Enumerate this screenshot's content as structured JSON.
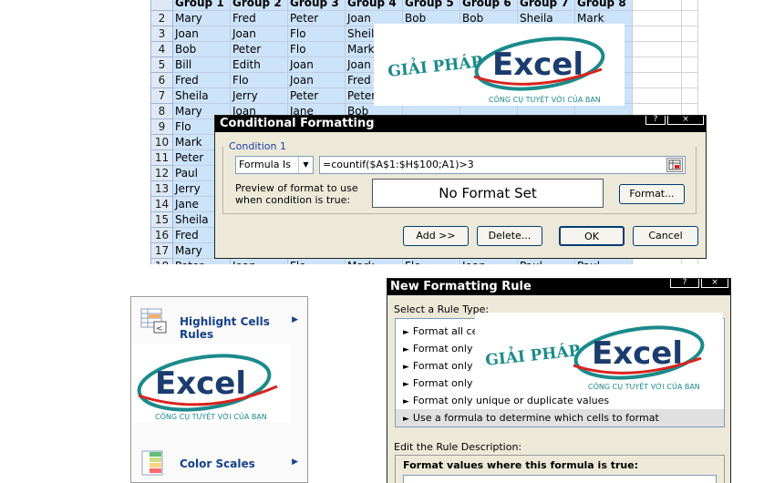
{
  "sheet": {
    "header_row": [
      "",
      "Group 1",
      "Group 2",
      "Group 3",
      "Group 4",
      "Group 5",
      "Group 6",
      "Group 7",
      "Group 8",
      "",
      ""
    ],
    "rows": [
      {
        "n": "2",
        "cells": [
          "Mary",
          "Fred",
          "Peter",
          "Joan",
          "Bob",
          "Bob",
          "Sheila",
          "Mark"
        ]
      },
      {
        "n": "3",
        "cells": [
          "Joan",
          "Joan",
          "Flo",
          "Sheila",
          "",
          "",
          "",
          ""
        ]
      },
      {
        "n": "4",
        "cells": [
          "Bob",
          "Peter",
          "Flo",
          "Mark",
          "",
          "",
          "",
          ""
        ]
      },
      {
        "n": "5",
        "cells": [
          "Bill",
          "Edith",
          "Joan",
          "Joan",
          "",
          "",
          "",
          ""
        ]
      },
      {
        "n": "6",
        "cells": [
          "Fred",
          "Flo",
          "Joan",
          "Fred",
          "",
          "",
          "",
          ""
        ]
      },
      {
        "n": "7",
        "cells": [
          "Sheila",
          "Jerry",
          "Peter",
          "Peter",
          "",
          "",
          "",
          ""
        ]
      },
      {
        "n": "8",
        "cells": [
          "Mary",
          "Joan",
          "Jane",
          "Bob",
          "",
          "",
          "",
          ""
        ]
      },
      {
        "n": "9",
        "cells": [
          "Flo",
          "",
          "",
          "",
          "",
          "",
          "",
          ""
        ]
      },
      {
        "n": "10",
        "cells": [
          "Mark",
          "",
          "",
          "",
          "",
          "",
          "",
          ""
        ]
      },
      {
        "n": "11",
        "cells": [
          "Peter",
          "",
          "",
          "",
          "",
          "",
          "",
          ""
        ]
      },
      {
        "n": "12",
        "cells": [
          "Paul",
          "",
          "",
          "",
          "",
          "",
          "",
          ""
        ]
      },
      {
        "n": "13",
        "cells": [
          "Jerry",
          "",
          "",
          "",
          "",
          "",
          "",
          ""
        ]
      },
      {
        "n": "14",
        "cells": [
          "Jane",
          "",
          "",
          "",
          "",
          "",
          "",
          ""
        ]
      },
      {
        "n": "15",
        "cells": [
          "Sheila",
          "",
          "",
          "",
          "",
          "",
          "",
          ""
        ]
      },
      {
        "n": "16",
        "cells": [
          "Fred",
          "",
          "",
          "",
          "",
          "",
          "",
          ""
        ]
      },
      {
        "n": "17",
        "cells": [
          "Mary",
          "",
          "",
          "",
          "",
          "",
          "",
          ""
        ]
      },
      {
        "n": "18",
        "cells": [
          "Peter",
          "Joan",
          "Flo",
          "Mark",
          "Flo",
          "Joan",
          "Paul",
          "Paul"
        ]
      }
    ]
  },
  "logo": {
    "prefix": "GIẢI PHÁP",
    "brand": "Excel",
    "slogan": "CÔNG CỤ TUYỆT VỜI CỦA BẠN",
    "colors": {
      "teal": "#1b8a8a",
      "red": "#d9231f",
      "navy": "#1b3c6e"
    }
  },
  "cf_dialog": {
    "title": "Conditional Formatting",
    "condition_label": "Condition 1",
    "type_value": "Formula Is",
    "formula": "=countif($A$1:$H$100;A1)>3",
    "preview_label": "Preview of format to use when condition is true:",
    "preview_text": "No Format Set",
    "format_button": "Format...",
    "add_button": "Add >>",
    "delete_button": "Delete...",
    "ok_button": "OK",
    "cancel_button": "Cancel",
    "help_glyph": "?",
    "close_glyph": "×"
  },
  "cf_menu": {
    "items": [
      {
        "label": "Highlight Cells Rules",
        "arrow": "▶"
      },
      {
        "label": "Color Scales",
        "arrow": "▶"
      }
    ]
  },
  "nfr_dialog": {
    "title": "New Formatting Rule",
    "select_label": "Select a Rule Type:",
    "rules": [
      "Format all cells based on their values",
      "Format only cells that contain",
      "Format only top or bottom ranked values",
      "Format only values that are above or below average",
      "Format only unique or duplicate values",
      "Use a formula to determine which cells to format"
    ],
    "rule_marker": "►",
    "edit_label": "Edit the Rule Description:",
    "desc_title": "Format values where this formula is true:",
    "help_glyph": "?",
    "close_glyph": "×"
  }
}
